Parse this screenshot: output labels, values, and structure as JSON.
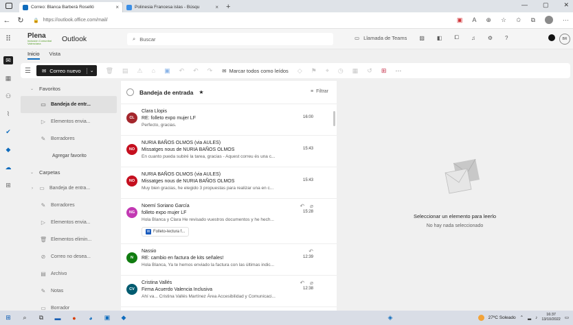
{
  "browser": {
    "tabs": [
      {
        "label": "Correo: Blanca Barberá Roselló",
        "close": "×"
      },
      {
        "label": "Polinesia Francesa islas - Búsqu",
        "close": "×"
      }
    ],
    "new_tab": "+",
    "url": "https://outlook.office.com/mail/"
  },
  "header": {
    "logo_text": "Plena",
    "logo_subtext": "inclusión Comunitat Valenciana",
    "app_name": "Outlook",
    "search_placeholder": "Buscar",
    "teams_label": "Llamada de Teams",
    "help": "?",
    "user_initials": "BR"
  },
  "ribbon": {
    "tabs": [
      "Inicio",
      "Vista"
    ],
    "new_mail": "Correo nuevo",
    "mark_all_read": "Marcar todos como leídos",
    "more": "···"
  },
  "folders": {
    "favorites_label": "Favoritos",
    "favorites": [
      {
        "label": "Bandeja de entr...",
        "selected": true
      },
      {
        "label": "Elementos envia..."
      },
      {
        "label": "Borradores"
      }
    ],
    "add_favorite": "Agregar favorito",
    "folders_label": "Carpetas",
    "folder_items": [
      {
        "label": "Bandeja de entra..."
      },
      {
        "label": "Borradores"
      },
      {
        "label": "Elementos envia..."
      },
      {
        "label": "Elementos elimin..."
      },
      {
        "label": "Correo no desea..."
      },
      {
        "label": "Archivo"
      },
      {
        "label": "Notas"
      },
      {
        "label": "Borrador"
      }
    ]
  },
  "message_list": {
    "title": "Bandeja de entrada",
    "filter": "Filtrar",
    "messages": [
      {
        "initials": "CL",
        "color": "#a4262c",
        "from": "Clara Llopis",
        "subject": "RE: folleto expo mujer LF",
        "preview": "Perfecto, gracias.",
        "time": "16:00"
      },
      {
        "initials": "NO",
        "color": "#c50f1f",
        "from": "NURIA BAÑOS OLMOS (via AULES)",
        "subject": "Missatges nous de NURIA BAÑOS OLMOS",
        "preview": "En cuanto pueda subiré la tarea, gracias - Aquest correu és una c...",
        "time": "15:43"
      },
      {
        "initials": "NO",
        "color": "#c50f1f",
        "from": "NURIA BAÑOS OLMOS (via AULES)",
        "subject": "Missatges nous de NURIA BAÑOS OLMOS",
        "preview": "Muy bien gracias, he elegido 3 propuestas para realizar una en c...",
        "time": "15:43"
      },
      {
        "initials": "NG",
        "color": "#c239b3",
        "from": "Noemí Soriano García",
        "subject": "folleto expo mujer LF",
        "preview": "Hola Blanca y Clara He revisado vuestros documentos y he hech...",
        "time": "15:28",
        "attachment": "Folleto-lectura f..."
      },
      {
        "initials": "N",
        "color": "#107c10",
        "from": "Nassio",
        "subject": "RE: cambio en factura de kits señales!",
        "preview": "Hola Blanca, Ya te hemos enviado la factura con las últimas indic...",
        "time": "12:39"
      },
      {
        "initials": "CV",
        "color": "#005b70",
        "from": "Cristina Vallés",
        "subject": "Firma Acuerdo Valencia Inclusiva",
        "preview": "Ahí va... Cristina Vallés Martínez Área Accesibilidad y Comunicaci...",
        "time": "12:38"
      }
    ]
  },
  "reading_pane": {
    "title": "Seleccionar un elemento para leerlo",
    "subtitle": "No hay nada seleccionado"
  },
  "taskbar": {
    "weather": "27ºC Soleado",
    "time": "16:37",
    "date": "13/10/2022"
  }
}
